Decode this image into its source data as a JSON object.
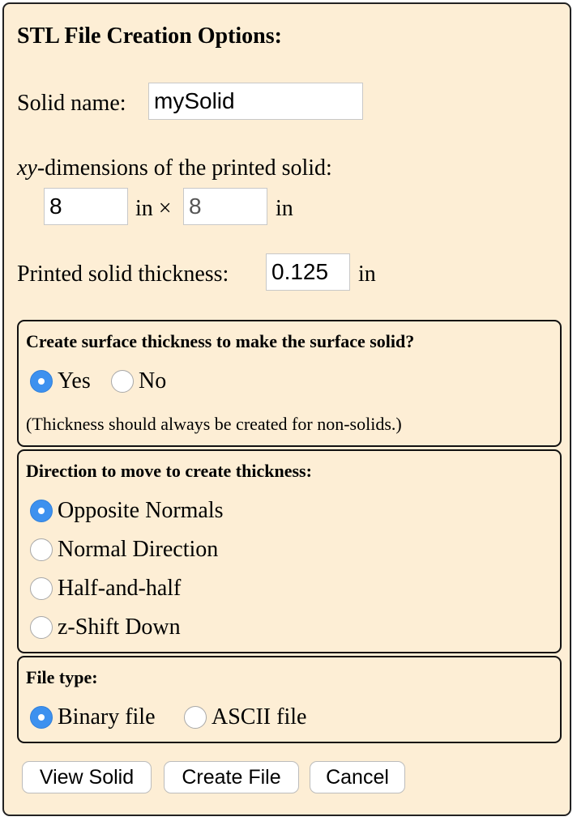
{
  "title": "STL File Creation Options:",
  "solid_name": {
    "label": "Solid name:",
    "value": "mySolid"
  },
  "dimensions": {
    "label_italic": "xy",
    "label_rest": "-dimensions of the printed solid:",
    "x_value": "8",
    "unit_times": "in ×",
    "y_value": "8",
    "unit": "in"
  },
  "thickness": {
    "label": "Printed solid thickness:",
    "value": "0.125",
    "unit": "in"
  },
  "surface_group": {
    "title": "Create surface thickness to make the surface solid?",
    "options": [
      {
        "label": "Yes",
        "checked": true
      },
      {
        "label": "No",
        "checked": false
      }
    ],
    "note": "(Thickness should always be created for non-solids.)"
  },
  "direction_group": {
    "title": "Direction to move to create thickness:",
    "options": [
      {
        "label": "Opposite Normals",
        "checked": true
      },
      {
        "label": "Normal Direction",
        "checked": false
      },
      {
        "label": "Half-and-half",
        "checked": false
      },
      {
        "label": "z-Shift Down",
        "checked": false
      }
    ]
  },
  "filetype_group": {
    "title": "File type:",
    "options": [
      {
        "label": "Binary file",
        "checked": true
      },
      {
        "label": "ASCII file",
        "checked": false
      }
    ]
  },
  "buttons": {
    "view": "View Solid",
    "create": "Create File",
    "cancel": "Cancel"
  },
  "colors": {
    "panel_bg": "#fdeed5",
    "radio_checked": "#3d91ef"
  }
}
